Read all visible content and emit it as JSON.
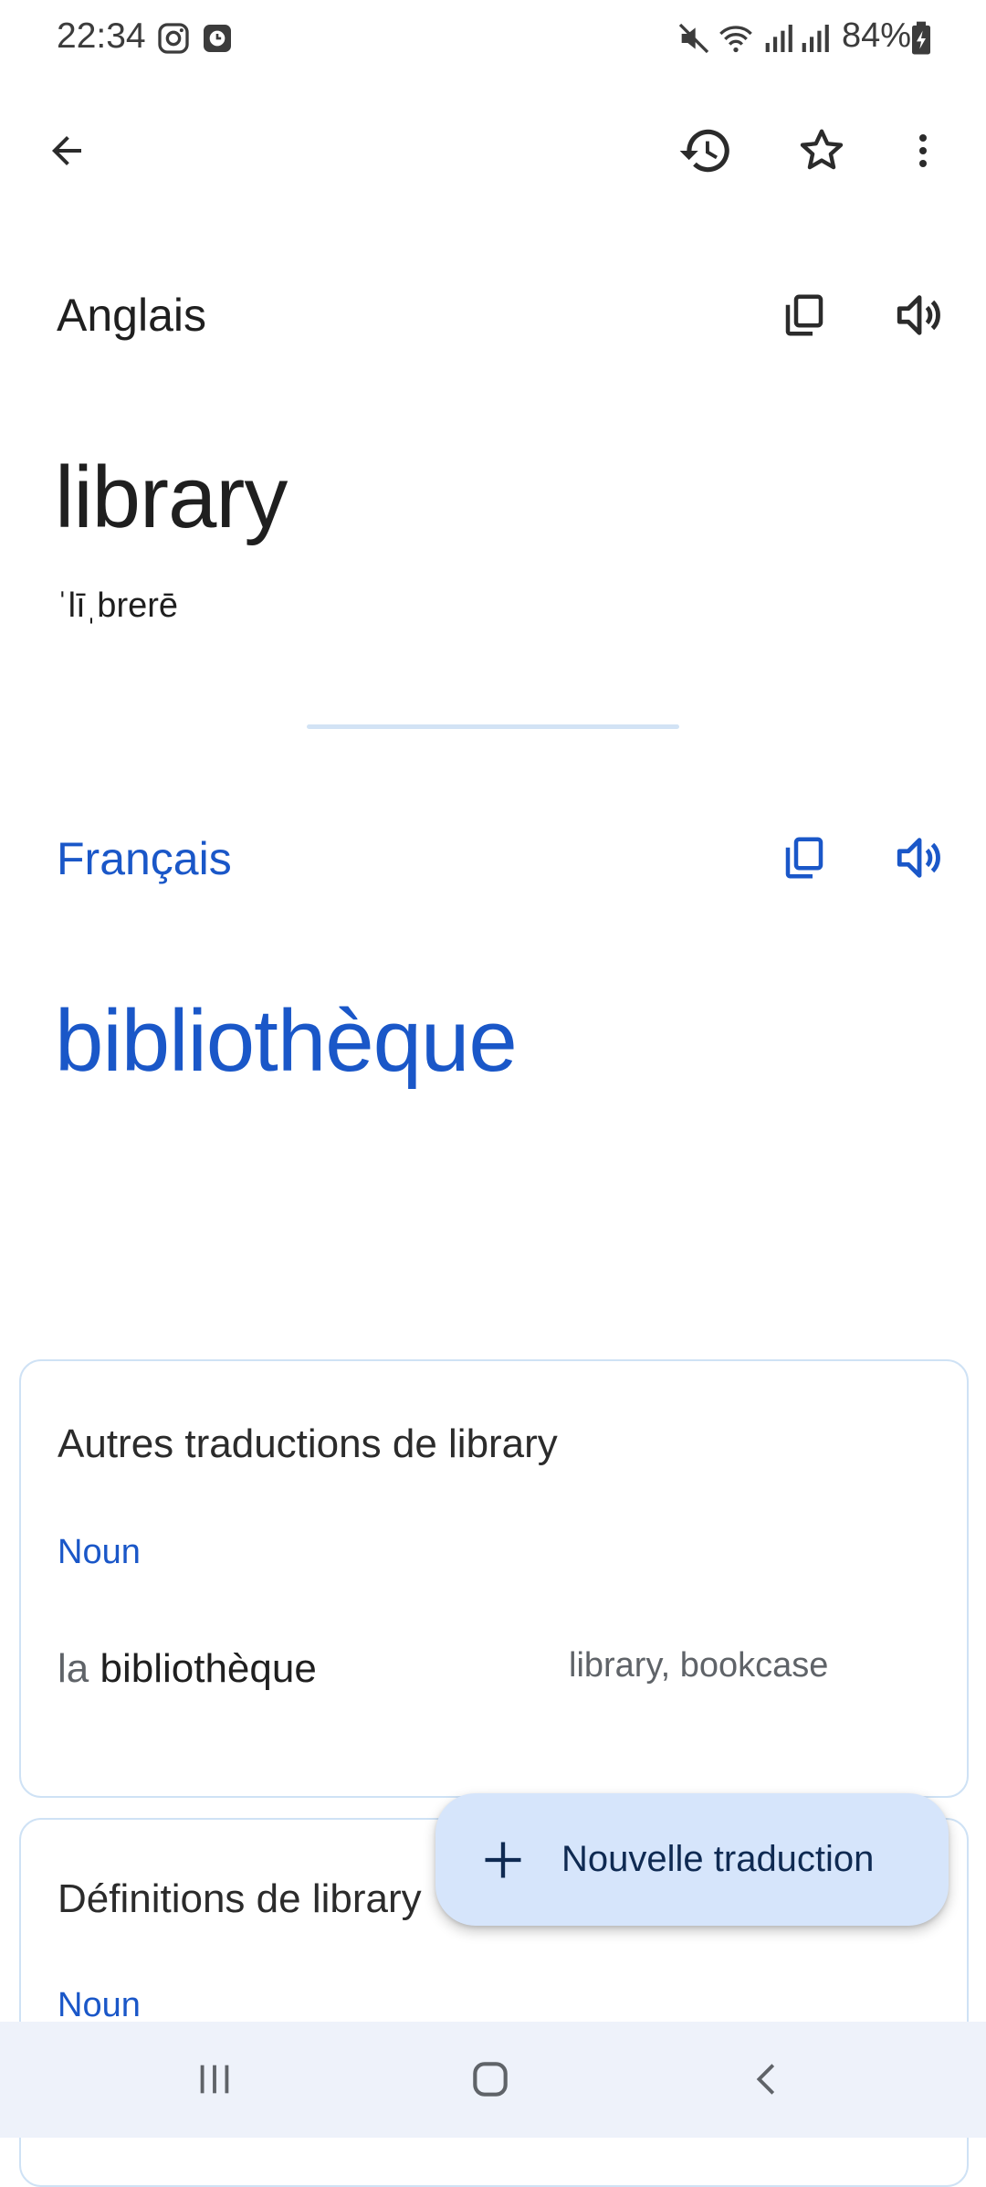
{
  "status_bar": {
    "time": "22:34",
    "battery": "84%",
    "icons": [
      "instagram-icon",
      "clock-app-icon",
      "mute-icon",
      "wifi-icon",
      "signal-icon",
      "signal-icon",
      "battery-charging-icon"
    ]
  },
  "app_bar": {
    "icons": [
      "back-arrow-icon",
      "history-icon",
      "star-icon",
      "more-vert-icon"
    ]
  },
  "source": {
    "language": "Anglais",
    "text": "library",
    "phonetic": "ˈlīˌbrerē"
  },
  "target": {
    "language": "Français",
    "text": "bibliothèque"
  },
  "other_translations": {
    "title": "Autres traductions de library",
    "pos": "Noun",
    "rows": [
      {
        "article": "la",
        "word": "bibliothèque",
        "synonyms": "library, bookcase"
      }
    ]
  },
  "definitions": {
    "title": "Définitions de library",
    "pos": "Noun"
  },
  "fab": {
    "label": "Nouvelle traduction"
  },
  "colors": {
    "accent": "#1a57c8",
    "fab_bg": "#d6e5fb",
    "card_border": "#cfe2f5",
    "nav_bg": "#eef2fa"
  }
}
